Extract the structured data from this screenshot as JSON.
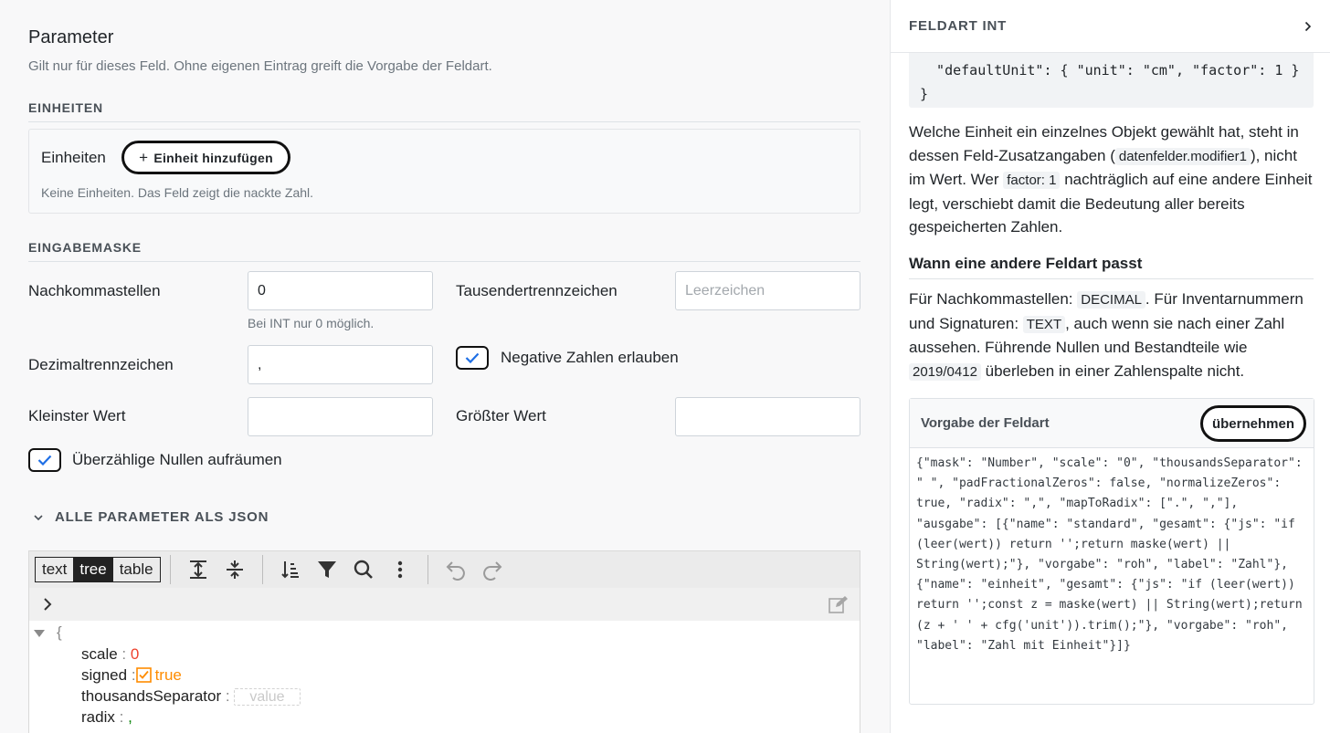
{
  "main": {
    "title": "Parameter",
    "subtitle": "Gilt nur für dieses Feld. Ohne eigenen Eintrag greift die Vorgabe der Feldart.",
    "units_section": {
      "heading": "EINHEITEN",
      "label": "Einheiten",
      "add_button": "Einheit hinzufügen",
      "add_icon": "+",
      "empty_text": "Keine Einheiten. Das Feld zeigt die nackte Zahl."
    },
    "mask_section": {
      "heading": "EINGABEMASKE",
      "decimals": {
        "label": "Nachkommastellen",
        "value": "0",
        "hint": "Bei INT nur 0 möglich."
      },
      "thousands": {
        "label": "Tausendertrennzeichen",
        "placeholder": "Leerzeichen"
      },
      "radix": {
        "label": "Dezimaltrennzeichen",
        "value": ","
      },
      "negative": {
        "label": "Negative Zahlen erlauben",
        "checked": true
      },
      "min": {
        "label": "Kleinster Wert",
        "value": ""
      },
      "max": {
        "label": "Größter Wert",
        "value": ""
      },
      "normalize": {
        "label": "Überzählige Nullen aufräumen",
        "checked": true
      }
    },
    "json_section": {
      "toggle_label": "ALLE PARAMETER ALS JSON",
      "modes": [
        "text",
        "tree",
        "table"
      ],
      "active_mode": "tree",
      "tree": {
        "open_brace": "{",
        "rows": [
          {
            "key": "scale",
            "value": "0",
            "type": "number"
          },
          {
            "key": "signed",
            "value": "true",
            "type": "boolean"
          },
          {
            "key": "thousandsSeparator",
            "value": "value",
            "type": "empty"
          },
          {
            "key": "radix",
            "value": ",",
            "type": "string"
          }
        ]
      }
    }
  },
  "panel": {
    "title": "FELDART INT",
    "code_lines": [
      "  \"defaultUnit\": { \"unit\": \"cm\", \"factor\": 1 }",
      "}"
    ],
    "para1": {
      "t1": "Welche Einheit ein einzelnes Objekt gewählt hat, steht in dessen Feld-Zusatzangaben (",
      "c1": "datenfelder.modifier1",
      "t2": "), nicht im Wert. Wer ",
      "c2": "factor: 1",
      "t3": " nachträglich auf eine andere Einheit legt, verschiebt damit die Bedeutung aller bereits gespeicherten Zahlen."
    },
    "heading2": "Wann eine andere Feldart passt",
    "para2": {
      "t1": "Für Nachkommastellen: ",
      "c1": "DECIMAL",
      "t2": ". Für Inventarnummern und Signaturen: ",
      "c2": "TEXT",
      "t3": ", auch wenn sie nach einer Zahl aussehen. Führende Nullen und Bestandteile wie ",
      "c3": "2019/0412",
      "t4": " überleben in einer Zahlenspalte nicht."
    },
    "default_box": {
      "title": "Vorgabe der Feldart",
      "apply_button": "übernehmen",
      "json": "{\"mask\": \"Number\", \"scale\": \"0\", \"thousandsSeparator\": \" \", \"padFractionalZeros\": false, \"normalizeZeros\": true, \"radix\": \",\", \"mapToRadix\": [\".\", \",\"], \"ausgabe\": [{\"name\": \"standard\", \"gesamt\": {\"js\": \"if (leer(wert)) return '';return maske(wert) || String(wert);\"}, \"vorgabe\": \"roh\", \"label\": \"Zahl\"}, {\"name\": \"einheit\", \"gesamt\": {\"js\": \"if (leer(wert)) return '';const z = maske(wert) || String(wert);return (z + ' ' + cfg('unit')).trim();\"}, \"vorgabe\": \"roh\", \"label\": \"Zahl mit Einheit\"}]}"
    }
  }
}
